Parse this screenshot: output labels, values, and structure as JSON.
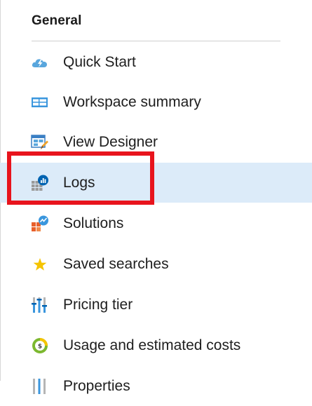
{
  "section": {
    "title": "General"
  },
  "nav_items": [
    {
      "label": "Quick Start",
      "icon": "cloud-lightning-icon"
    },
    {
      "label": "Workspace summary",
      "icon": "summary-grid-icon"
    },
    {
      "label": "View Designer",
      "icon": "view-designer-icon"
    },
    {
      "label": "Logs",
      "icon": "logs-icon",
      "selected": true
    },
    {
      "label": "Solutions",
      "icon": "solutions-icon"
    },
    {
      "label": "Saved searches",
      "icon": "star-icon"
    },
    {
      "label": "Pricing tier",
      "icon": "pricing-sliders-icon"
    },
    {
      "label": "Usage and estimated costs",
      "icon": "usage-cost-icon"
    },
    {
      "label": "Properties",
      "icon": "properties-icon"
    }
  ],
  "annotation": {
    "highlight_color": "#e8141d",
    "highlighted_item": "Logs"
  },
  "colors": {
    "selected_background": "#dcebf9",
    "icon_blue": "#3a96dd",
    "icon_dark_blue": "#0078d4",
    "icon_orange": "#e8602c",
    "star_yellow": "#f5c400",
    "usage_green": "#7cb82f"
  }
}
